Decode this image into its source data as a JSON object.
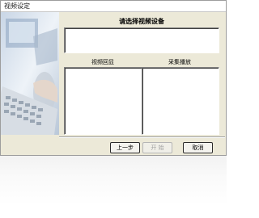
{
  "window": {
    "title": "视频设定"
  },
  "dialog": {
    "heading": "请选择视频设备",
    "preview_label": "视频回显",
    "format_label": "采集播放"
  },
  "buttons": {
    "prev": "上一步",
    "start": "开 始",
    "cancel": "取消"
  },
  "colors": {
    "dialog_bg": "#ece9d8",
    "list_bg": "#ffffff",
    "disabled_text": "#a0a0a0"
  }
}
